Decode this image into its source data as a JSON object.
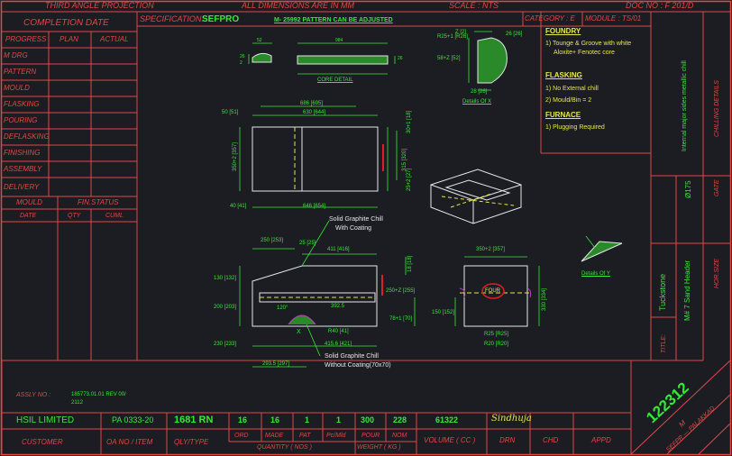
{
  "header": {
    "projection": "THIRD ANGLE PROJECTION",
    "dimensions_note": "ALL DIMENSIONS ARE IN MM",
    "scale": "SCALE : NTS",
    "doc_no": "DOC NO : F 201/D",
    "spec_label": "SPECIFICATION:",
    "spec_value": "SEFPRO",
    "pattern_note": "M- 25992 PATTERN CAN BE ADJUSTED",
    "category_label": "CATEGORY : E",
    "module_label": "MODULE : TS/01"
  },
  "schedule": {
    "title": "COMPLETION DATE",
    "cols": [
      "PROGRESS",
      "PLAN",
      "ACTUAL"
    ],
    "rows": [
      "M DRG",
      "PATTERN",
      "MOULD",
      "FLASKING",
      "POURING",
      "DEFLASKING",
      "FINISHING",
      "ASSEMBLY",
      "DELIVERY"
    ],
    "mould_label": "MOULD",
    "fin_status_label": "FIN.STATUS",
    "sub_cols": [
      "DATE",
      "QTY",
      "CUML"
    ]
  },
  "notes": {
    "foundry_title": "FOUNDRY",
    "foundry_1a": "1) Tounge & Groove with white",
    "foundry_1b": "Aloxite+ Fenotec core",
    "flasking_title": "FLASKING",
    "flasking_1": "1) No External chill",
    "flasking_2": "2) Mould/Bin = 2",
    "furnace_title": "FURNACE",
    "furnace_1": "1) Plugging Required",
    "vertical_note": "Internal major sides metallic chill",
    "chilling_details": "CHILLING DETAILS",
    "gate_label": "GATE",
    "gate_value": "Ø175",
    "hor_size": "HOR.SIZE",
    "title_label": "TITLE:",
    "title_value": "Tuckstone",
    "title_sub": "M# 7 Sand Header"
  },
  "drawing": {
    "core_detail": "CORE DETAIL",
    "details_of_x": "Details Of X",
    "details_of_y": "Details Of Y",
    "solid_chill_coating_1": "Solid Graphite Chill",
    "solid_chill_coating_2": "With Coating",
    "solid_chill_nocoat_1": "Solid Graphite Chill",
    "solid_chill_nocoat_2": "Without Coating(70x70)",
    "chill_mark": "X",
    "four_label": "FOUR",
    "dims": {
      "core_52": "52",
      "core_26a": "26",
      "core_26b": "2",
      "core_984": "984",
      "core_26c": "26",
      "x_r25": "R25+1 [R26]",
      "x_z": "Z [2]",
      "x_26": "26 [26]",
      "x_58": "58+Z [52]",
      "x_28": "28 [26]",
      "v_686": "686 [695]",
      "v_630": "630 [644]",
      "v_50": "50 [51]",
      "v_350": "350+2 [357]",
      "v_30": "30+1 [18]",
      "v_315": "315 [320]",
      "v_25": "25+2 [27]",
      "v_40": "40 [41]",
      "v_646": "646 [654]",
      "f_250": "250 [253]",
      "f_25": "25 [25]",
      "f_411": "411 [416]",
      "f_130": "130 [132]",
      "f_18": "18 [18]",
      "f_200": "200 [203]",
      "f_392": "392.5",
      "f_250b": "250+Z [255]",
      "f_78": "78+1 [70]",
      "f_120": "120°",
      "f_r40": "R40 [41]",
      "f_230": "230 [233]",
      "f_415": "415.6 [421]",
      "f_293": "293.5 [297]",
      "s_350": "350+2 [357]",
      "s_150": "150 [152]",
      "s_330": "330 [334]",
      "s_r25": "R25 [R25]",
      "s_r20": "R20 [R20]"
    }
  },
  "footer": {
    "assly_label": "ASSLY NO :",
    "assly_value_1": "185773.01.01 REV 00/",
    "assly_value_2": "2112",
    "customer_value": "HSIL LIMITED",
    "order_value": "PA 0333-20",
    "qty_type": "1681 RN",
    "qty_values": [
      "16",
      "16",
      "1",
      "1"
    ],
    "weight_values": [
      "300",
      "228"
    ],
    "volume_value": "61322",
    "signature": "Sindhuja",
    "drawing_no": "122312",
    "rev": "M",
    "place": "SEFPR — PALAKKAD",
    "labels": {
      "customer": "CUSTOMER",
      "order": "OA NO / ITEM",
      "qty_type": "QLY/TYPE",
      "ord": "ORD",
      "made": "MADE",
      "pat": "PAT",
      "pcs_mld": "Pc/Mld",
      "pour": "POUR",
      "nom": "NOM",
      "quantity": "QUANTITY ( NOS )",
      "weight": "WEIGHT ( KG )",
      "volume": "VOLUME ( CC )",
      "drn": "DRN",
      "chd": "CHD",
      "appd": "APPD"
    }
  },
  "colors": {
    "background": "#1b1d22",
    "border": "#e04848",
    "dimension": "#38e838",
    "geometry": "#e6e6e6",
    "centerline": "#e6e84a",
    "highlight": "#e02020",
    "cyan": "#3fd0d0"
  }
}
